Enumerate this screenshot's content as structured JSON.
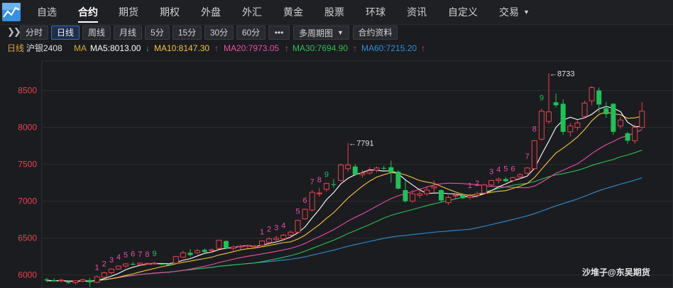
{
  "nav": {
    "items": [
      "自选",
      "合约",
      "期货",
      "期权",
      "外盘",
      "外汇",
      "黄金",
      "股票",
      "环球",
      "资讯",
      "自定义",
      "交易"
    ],
    "active_index": 1
  },
  "toolbar": {
    "collapse_icon": "double-chevron-right-icon",
    "buttons": [
      "分时",
      "日线",
      "周线",
      "月线",
      "5分",
      "15分",
      "30分",
      "60分",
      "•••",
      "多周期图",
      "合约资料"
    ],
    "active_index": 1
  },
  "legend": {
    "period": "日线",
    "contract": "沪银2408",
    "ma_label": "MA",
    "ma5": "MA5:8013.00",
    "ma10": "MA10:8147.30",
    "ma20": "MA20:7973.05",
    "ma30": "MA30:7694.90",
    "ma60": "MA60:7215.20",
    "arrow_up": "↑",
    "arrow_down": "↓",
    "colors": {
      "ma5": "#ffffff",
      "ma10": "#f5c242",
      "ma20": "#e84fa3",
      "ma30": "#2fbf52",
      "ma60": "#2e8ed6",
      "up": "#e8434c",
      "down": "#21c058",
      "label": "#d8a83a"
    }
  },
  "watermark": "沙堆子@东吴期货",
  "chart_data": {
    "type": "candlestick",
    "ylim": [
      5900,
      8900
    ],
    "y_ticks": [
      6000,
      6500,
      7000,
      7500,
      8000,
      8500
    ],
    "annotations": {
      "high": "8733",
      "mid_high": "7791",
      "low": "5839"
    },
    "candles": [
      [
        5940,
        5960,
        5900,
        5925
      ],
      [
        5930,
        5955,
        5905,
        5915
      ],
      [
        5920,
        5950,
        5900,
        5930
      ],
      [
        5900,
        5930,
        5880,
        5890
      ],
      [
        5895,
        5930,
        5870,
        5920
      ],
      [
        5915,
        5950,
        5900,
        5935
      ],
      [
        5930,
        5960,
        5839,
        5900
      ],
      [
        5900,
        5990,
        5890,
        5975
      ],
      [
        5970,
        6040,
        5960,
        6030
      ],
      [
        6030,
        6090,
        6010,
        6080
      ],
      [
        6080,
        6130,
        6070,
        6120
      ],
      [
        6120,
        6160,
        6100,
        6150
      ],
      [
        6150,
        6175,
        6130,
        6145
      ],
      [
        6140,
        6170,
        6120,
        6160
      ],
      [
        6150,
        6170,
        6140,
        6155
      ],
      [
        6150,
        6180,
        6140,
        6160
      ],
      [
        6150,
        6170,
        6130,
        6145
      ],
      [
        6145,
        6160,
        6130,
        6140
      ],
      [
        6160,
        6260,
        6150,
        6250
      ],
      [
        6240,
        6330,
        6230,
        6300
      ],
      [
        6300,
        6350,
        6250,
        6270
      ],
      [
        6300,
        6350,
        6280,
        6330
      ],
      [
        6340,
        6360,
        6290,
        6310
      ],
      [
        6330,
        6360,
        6300,
        6340
      ],
      [
        6360,
        6480,
        6350,
        6470
      ],
      [
        6460,
        6470,
        6350,
        6360
      ],
      [
        6360,
        6400,
        6330,
        6380
      ],
      [
        6380,
        6410,
        6350,
        6390
      ],
      [
        6390,
        6410,
        6360,
        6400
      ],
      [
        6380,
        6410,
        6360,
        6390
      ],
      [
        6400,
        6470,
        6390,
        6460
      ],
      [
        6440,
        6510,
        6420,
        6490
      ],
      [
        6480,
        6530,
        6450,
        6500
      ],
      [
        6490,
        6560,
        6470,
        6540
      ],
      [
        6540,
        6600,
        6500,
        6580
      ],
      [
        6580,
        6750,
        6570,
        6740
      ],
      [
        6760,
        6900,
        6750,
        6890
      ],
      [
        6880,
        7150,
        6860,
        7120
      ],
      [
        7110,
        7180,
        7060,
        7110
      ],
      [
        7160,
        7250,
        7130,
        7240
      ],
      [
        7230,
        7300,
        7180,
        7220
      ],
      [
        7280,
        7510,
        7270,
        7490
      ],
      [
        7440,
        7791,
        7400,
        7490
      ],
      [
        7470,
        7500,
        7340,
        7360
      ],
      [
        7360,
        7420,
        7320,
        7380
      ],
      [
        7380,
        7460,
        7360,
        7410
      ],
      [
        7420,
        7470,
        7390,
        7450
      ],
      [
        7450,
        7480,
        7410,
        7440
      ],
      [
        7460,
        7550,
        7250,
        7390
      ],
      [
        7400,
        7420,
        7160,
        7170
      ],
      [
        7150,
        7280,
        6980,
        7000
      ],
      [
        7000,
        7150,
        6980,
        7100
      ],
      [
        7080,
        7180,
        7040,
        7100
      ],
      [
        7100,
        7200,
        7070,
        7150
      ],
      [
        7180,
        7280,
        7120,
        7200
      ],
      [
        7150,
        7160,
        6990,
        7010
      ],
      [
        6980,
        7080,
        6950,
        7050
      ],
      [
        7070,
        7100,
        7020,
        7080
      ],
      [
        7080,
        7110,
        7030,
        7040
      ],
      [
        7050,
        7100,
        7020,
        7070
      ],
      [
        7080,
        7130,
        7050,
        7100
      ],
      [
        7110,
        7240,
        7100,
        7220
      ],
      [
        7220,
        7290,
        7200,
        7280
      ],
      [
        7280,
        7320,
        7240,
        7300
      ],
      [
        7300,
        7330,
        7260,
        7270
      ],
      [
        7280,
        7330,
        7260,
        7320
      ],
      [
        7330,
        7380,
        7300,
        7360
      ],
      [
        7380,
        7460,
        7360,
        7450
      ],
      [
        7440,
        7830,
        7430,
        7820
      ],
      [
        7840,
        8250,
        7820,
        8220
      ],
      [
        8080,
        8733,
        8050,
        8210
      ],
      [
        8340,
        8460,
        8270,
        8300
      ],
      [
        8320,
        8380,
        7900,
        7940
      ],
      [
        7940,
        8060,
        7880,
        8020
      ],
      [
        8000,
        8100,
        7960,
        8060
      ],
      [
        8150,
        8360,
        8120,
        8330
      ],
      [
        8360,
        8560,
        8300,
        8540
      ],
      [
        8500,
        8540,
        8200,
        8310
      ],
      [
        8260,
        8340,
        8130,
        8180
      ],
      [
        8320,
        8330,
        7900,
        7940
      ],
      [
        8020,
        8140,
        7980,
        8100
      ],
      [
        7920,
        7940,
        7780,
        7820
      ],
      [
        7820,
        8040,
        7780,
        8000
      ],
      [
        8000,
        8340,
        7980,
        8220
      ]
    ]
  }
}
